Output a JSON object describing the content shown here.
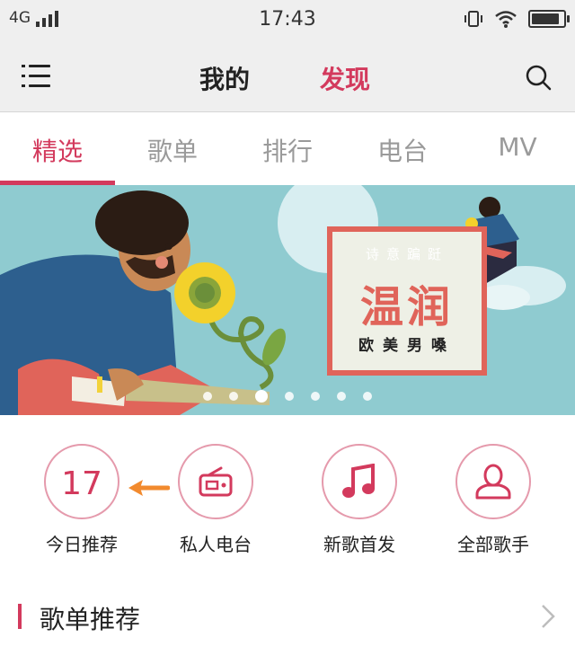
{
  "status_bar": {
    "network": "4G",
    "time": "17:43",
    "battery_level": 1.0
  },
  "nav": {
    "mine_label": "我的",
    "discover_label": "发现",
    "active": "discover"
  },
  "tabs": [
    {
      "label": "精选",
      "active": true
    },
    {
      "label": "歌单",
      "active": false
    },
    {
      "label": "排行",
      "active": false
    },
    {
      "label": "电台",
      "active": false
    },
    {
      "label": "MV",
      "active": false
    }
  ],
  "banner": {
    "tagline": "诗意蹁跹",
    "headline": "温润",
    "subline": "欧美男嗓",
    "slide_count": 7,
    "active_slide": 3
  },
  "shortcuts": [
    {
      "label": "今日推荐",
      "icon": "calendar-icon",
      "value": "17"
    },
    {
      "label": "私人电台",
      "icon": "radio-icon"
    },
    {
      "label": "新歌首发",
      "icon": "music-note-icon"
    },
    {
      "label": "全部歌手",
      "icon": "person-icon"
    }
  ],
  "section": {
    "title": "歌单推荐"
  },
  "colors": {
    "accent": "#d33a5d",
    "annotation_arrow": "#f28a2e",
    "banner_bg": "#8fcbd0"
  }
}
